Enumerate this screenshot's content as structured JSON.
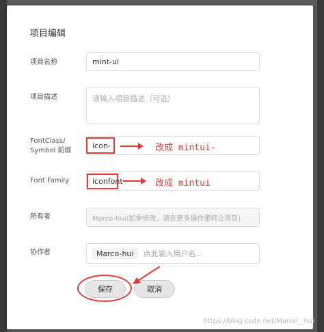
{
  "dialog": {
    "title": "项目编辑",
    "fields": {
      "name": {
        "label": "项目名称",
        "value": "mint-ui"
      },
      "desc": {
        "label": "项目描述",
        "placeholder": "请输入项目描述（可选）"
      },
      "font_class": {
        "label_line1": "FontClass/",
        "label_line2": "Symbol 前缀",
        "value": "icon-"
      },
      "font_family": {
        "label": "Font Family",
        "value": "iconfont"
      },
      "owner": {
        "label": "所有者",
        "value": "Marco-hui(如需修改，请在更多操作里转让项目)"
      },
      "collaborators": {
        "label": "协作者",
        "tag": "Marco-hui",
        "placeholder": "点此输入用户名..."
      }
    },
    "buttons": {
      "save": "保存",
      "cancel": "取消"
    }
  },
  "annotations": {
    "font_class_note": "改成 mintui-",
    "font_family_note": "改成 mintui",
    "color": "#e53935"
  },
  "watermark": "https://blog.csdn.net/Marco__hui"
}
